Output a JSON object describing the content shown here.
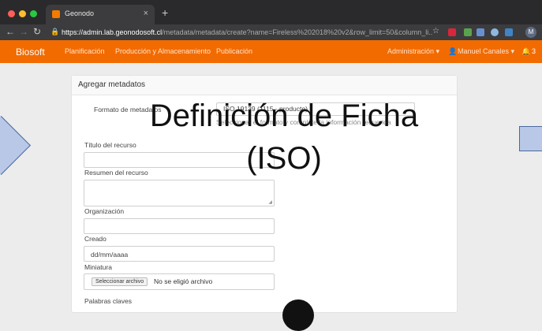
{
  "browser": {
    "tab_title": "Geonodo",
    "tab_close": "×",
    "new_tab": "+",
    "url_host": "https://admin.lab.geonodosoft.cl",
    "url_path": "/metadata/metadata/create?name=Fireless%202018%20v2&row_limit=50&column_li...",
    "profile_initial": "M"
  },
  "navbar": {
    "brand": "Biosoft",
    "items": [
      "Planificación",
      "Producción y Almacenamiento",
      "Publicación"
    ],
    "admin": "Administración ▾",
    "user": "Manuel Canales ▾",
    "notifications": "3"
  },
  "form": {
    "card_title": "Agregar metadatos",
    "schema_label": "Formato de metadatos",
    "schema_value": "ISO 19139 (1115 - producto)",
    "schema_help": "Seleccionar el formato y complete la información requerida",
    "titulo_label": "Título del recurso",
    "resumen_label": "Resumen del recurso",
    "organizacion_label": "Organización",
    "creado_label": "Creado",
    "creado_placeholder": "dd/mm/aaaa",
    "miniatura_label": "Miniatura",
    "file_button": "Seleccionar archivo",
    "file_none": "No se eligió archivo",
    "keywords_label": "Palabras claves"
  },
  "overlay": {
    "line1": "Definición de Ficha",
    "line2": "(ISO)"
  },
  "colors": {
    "navbar": "#f26b00",
    "chrome": "#2a2a2c",
    "diagram_fill": "#b8c8e6"
  }
}
